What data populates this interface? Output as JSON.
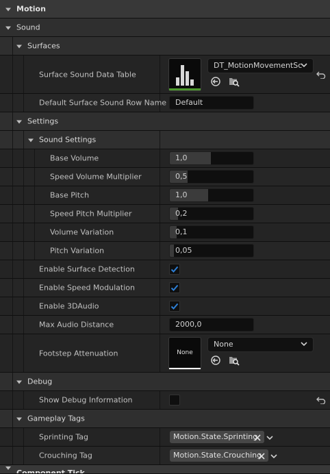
{
  "sections": {
    "motion": "Motion",
    "sound": "Sound",
    "surfaces": "Surfaces",
    "settings": "Settings",
    "sound_settings": "Sound Settings",
    "debug": "Debug",
    "gameplay_tags": "Gameplay Tags",
    "component_tick": "Component Tick"
  },
  "surfaces": {
    "data_table_label": "Surface Sound Data Table",
    "data_table_value": "DT_MotionMovementSc",
    "default_row_label": "Default Surface Sound Row Name",
    "default_row_value": "Default"
  },
  "sound_settings": {
    "base_volume": {
      "label": "Base Volume",
      "value": "1,0",
      "fill": 0.5
    },
    "speed_volume_multiplier": {
      "label": "Speed Volume Multiplier",
      "value": "0,5",
      "fill": 0.2
    },
    "base_pitch": {
      "label": "Base Pitch",
      "value": "1,0",
      "fill": 0.45
    },
    "speed_pitch_multiplier": {
      "label": "Speed Pitch Multiplier",
      "value": "0,2",
      "fill": 0.1
    },
    "volume_variation": {
      "label": "Volume Variation",
      "value": "0,1",
      "fill": 0.08
    },
    "pitch_variation": {
      "label": "Pitch Variation",
      "value": "0,05",
      "fill": 0.05
    }
  },
  "settings": {
    "enable_surface_detection": {
      "label": "Enable Surface Detection",
      "checked": true
    },
    "enable_speed_modulation": {
      "label": "Enable Speed Modulation",
      "checked": true
    },
    "enable_3daudio": {
      "label": "Enable 3DAudio",
      "checked": true
    },
    "max_audio_distance": {
      "label": "Max Audio Distance",
      "value": "2000,0"
    },
    "footstep_attenuation": {
      "label": "Footstep Attenuation",
      "thumb": "None",
      "value": "None"
    }
  },
  "debug": {
    "show_debug_info": {
      "label": "Show Debug Information",
      "checked": false
    }
  },
  "gameplay_tags": {
    "sprinting": {
      "label": "Sprinting Tag",
      "value": "Motion.State.Sprinting"
    },
    "crouching": {
      "label": "Crouching Tag",
      "value": "Motion.State.Crouching"
    }
  },
  "colors": {
    "check_blue": "#2d7fd6",
    "thumb_green": "#4e9a2e"
  }
}
